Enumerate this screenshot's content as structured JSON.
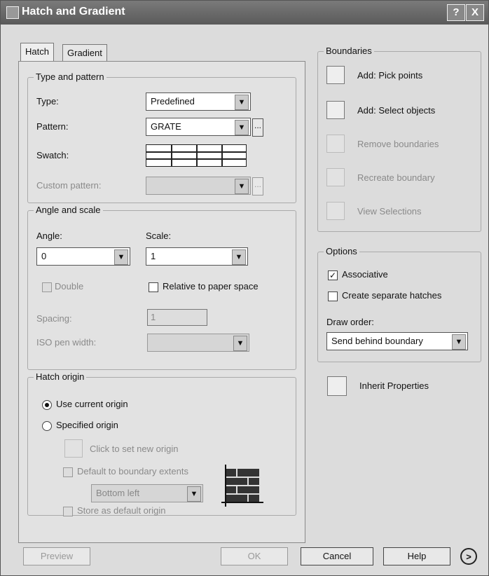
{
  "window": {
    "title": "Hatch and Gradient",
    "help_button": "?",
    "close_button": "X"
  },
  "tabs": [
    {
      "label": "Hatch"
    },
    {
      "label": "Gradient"
    }
  ],
  "type_pattern": {
    "group_title": "Type and pattern",
    "type_label": "Type:",
    "type_value": "Predefined",
    "pattern_label": "Pattern:",
    "pattern_value": "GRATE",
    "ellipsis": "...",
    "swatch_label": "Swatch:",
    "custom_label": "Custom pattern:"
  },
  "angle_scale": {
    "group_title": "Angle and scale",
    "angle_label": "Angle:",
    "angle_value": "0",
    "scale_label": "Scale:",
    "scale_value": "1",
    "double_label": "Double",
    "relative_label": "Relative to paper space",
    "spacing_label": "Spacing:",
    "spacing_value": "1",
    "iso_label": "ISO pen width:"
  },
  "hatch_origin": {
    "group_title": "Hatch origin",
    "use_current": "Use current origin",
    "specified": "Specified origin",
    "click_set": "Click to set new origin",
    "default_extents": "Default to boundary extents",
    "position_value": "Bottom left",
    "store_default": "Store as default origin"
  },
  "boundaries": {
    "group_title": "Boundaries",
    "add_pick": "Add: Pick points",
    "add_select": "Add: Select objects",
    "remove": "Remove boundaries",
    "recreate": "Recreate boundary",
    "view": "View Selections"
  },
  "options": {
    "group_title": "Options",
    "associative": "Associative",
    "separate": "Create separate hatches",
    "draw_order_label": "Draw order:",
    "draw_order_value": "Send behind boundary"
  },
  "inherit": "Inherit Properties",
  "footer": {
    "preview": "Preview",
    "ok": "OK",
    "cancel": "Cancel",
    "help": "Help",
    "more": ">"
  }
}
